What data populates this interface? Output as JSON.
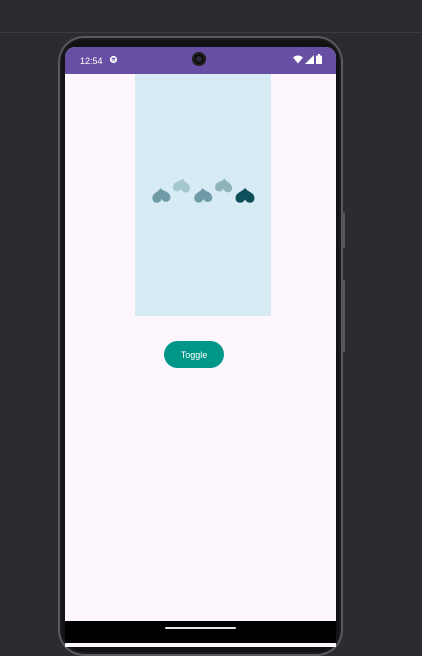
{
  "status_bar": {
    "time": "12:54",
    "background_color": "#6750a4",
    "icons": [
      "notification-icon",
      "wifi-icon",
      "signal-icon",
      "battery-icon"
    ]
  },
  "preview": {
    "background_color": "#d6ebf4",
    "hearts": [
      {
        "name": "heart-1",
        "color": "#6e9ba6"
      },
      {
        "name": "heart-2",
        "color": "#a4c8cf"
      },
      {
        "name": "heart-3",
        "color": "#6e9ba6"
      },
      {
        "name": "heart-4",
        "color": "#8fb4bc"
      },
      {
        "name": "heart-5",
        "color": "#0f4f5c"
      }
    ]
  },
  "toggle_button": {
    "label": "Toggle",
    "color": "#009688"
  }
}
